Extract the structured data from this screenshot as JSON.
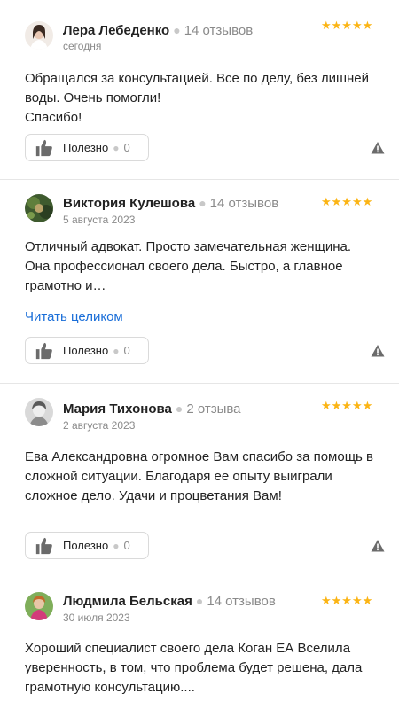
{
  "reviews": [
    {
      "name": "Лера Лебеденко",
      "reviews_count": "14 отзывов",
      "date": "сегодня",
      "rating": 5,
      "text": "Обращался за консультацией. Все по делу, без лишней воды. Очень помогли!\nСпасибо!",
      "read_more": "",
      "useful_label": "Полезно",
      "useful_count": "0"
    },
    {
      "name": "Виктория Кулешова",
      "reviews_count": "14 отзывов",
      "date": "5 августа 2023",
      "rating": 5,
      "text": "Отличный адвокат. Просто замечательная женщина. Она профессионал своего дела. Быстро, а главное грамотно и…",
      "read_more": "Читать целиком",
      "useful_label": "Полезно",
      "useful_count": "0"
    },
    {
      "name": "Мария Тихонова",
      "reviews_count": "2 отзыва",
      "date": "2 августа 2023",
      "rating": 5,
      "text": "Ева Александровна огромное Вам спасибо за помощь в сложной ситуации. Благодаря ее опыту выиграли сложное дело. Удачи и процветания Вам!",
      "read_more": "",
      "useful_label": "Полезно",
      "useful_count": "0"
    },
    {
      "name": "Людмила Бельская",
      "reviews_count": "14 отзывов",
      "date": "30 июля 2023",
      "rating": 5,
      "text": "Хороший специалист своего дела Коган ЕА Вселила уверенность, в том, что проблема будет решена, дала грамотную консультацию....",
      "read_more": "",
      "useful_label": "",
      "useful_count": ""
    }
  ],
  "star_glyph": "★★★★★",
  "colors": {
    "star": "#fbb414",
    "link": "#1a6ed8",
    "muted": "#8a8a8a"
  },
  "icons": {
    "thumb": "thumbs-up-icon",
    "warn": "warning-triangle-icon"
  }
}
